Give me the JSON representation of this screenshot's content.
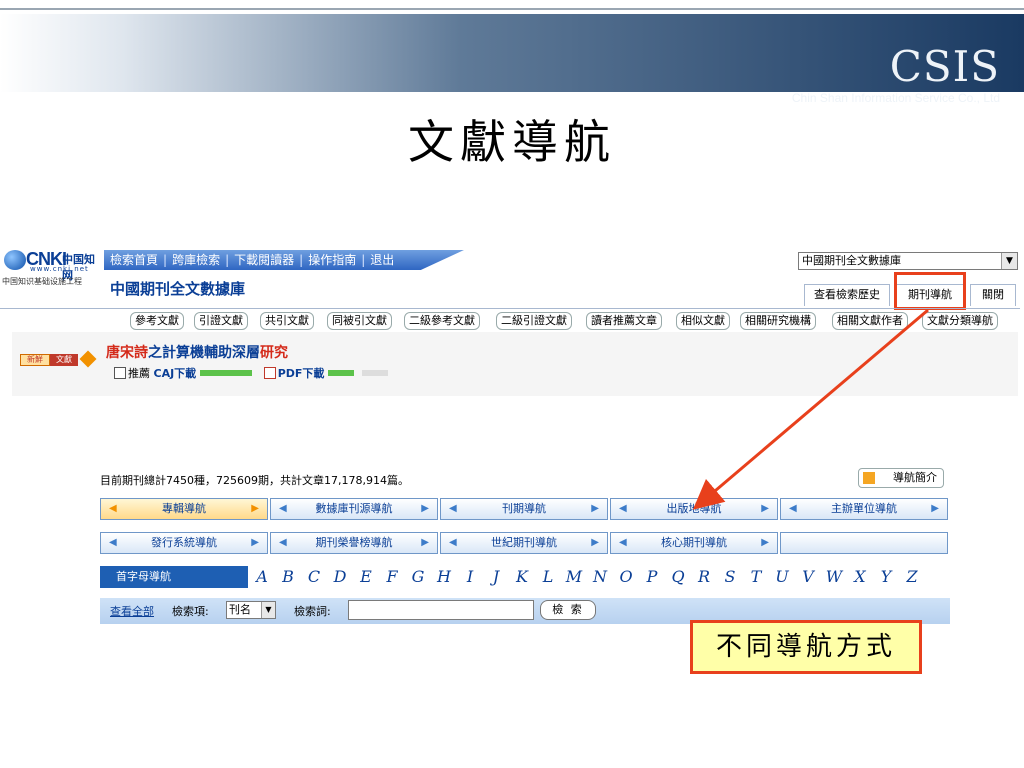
{
  "slide": {
    "logo": "CSIS",
    "company": "Chin Shan Information Service Co., Ltd",
    "title": "文獻導航"
  },
  "cnki": {
    "logo_brand": "CNKI",
    "logo_cn": "中国知网",
    "logo_url": "www.cnki.net",
    "subtitle": "中国知识基础设施工程",
    "nav_items": [
      "檢索首頁",
      "跨庫檢索",
      "下載閱讀器",
      "操作指南",
      "退出"
    ],
    "db_title": "中國期刊全文數據庫",
    "db_select_value": "中國期刊全文數據庫",
    "tabs": {
      "history": "查看檢索歷史",
      "journal_nav": "期刊導航",
      "close": "關閉"
    },
    "ref_buttons": [
      "參考文獻",
      "引證文獻",
      "共引文獻",
      "同被引文獻",
      "二級參考文獻",
      "二級引證文獻",
      "讀者推薦文章",
      "相似文獻",
      "相關研究機構",
      "相關文獻作者",
      "文獻分類導航"
    ],
    "new_badge": [
      "新鮮",
      "文獻"
    ],
    "article": {
      "title_part1": "唐宋詩",
      "title_part2": "之計算機輔助深層",
      "title_part3": "研究",
      "recommend": "推薦",
      "caj": "CAJ下載",
      "pdf": "PDF下載"
    }
  },
  "journal_nav": {
    "stats": "目前期刊總計7450種，725609期，共計文章17,178,914篇。",
    "intro_button": "導航簡介",
    "row1": [
      "專輯導航",
      "數據庫刊源導航",
      "刊期導航",
      "出版地導航",
      "主辦單位導航"
    ],
    "row2": [
      "發行系統導航",
      "期刊榮譽榜導航",
      "世紀期刊導航",
      "核心期刊導航"
    ],
    "letter_label": "首字母導航",
    "letters": [
      "A",
      "B",
      "C",
      "D",
      "E",
      "F",
      "G",
      "H",
      "I",
      "J",
      "K",
      "L",
      "M",
      "N",
      "O",
      "P",
      "Q",
      "R",
      "S",
      "T",
      "U",
      "V",
      "W",
      "X",
      "Y",
      "Z"
    ],
    "search": {
      "view_all": "查看全部",
      "field_label": "檢索項:",
      "field_value": "刊名",
      "keyword_label": "檢索詞:",
      "keyword_value": "",
      "button": "檢 索"
    }
  },
  "callout": "不同導航方式",
  "colors": {
    "highlight": "#e8401c",
    "cnki_blue": "#0b3f96",
    "callout_bg": "#ffffa8"
  }
}
